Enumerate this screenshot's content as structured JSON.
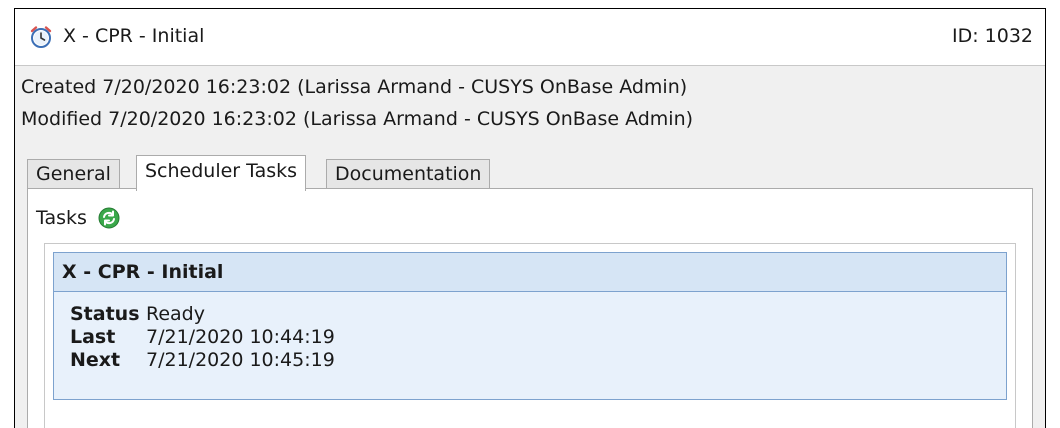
{
  "header": {
    "icon": "alarm-clock-icon",
    "title": "X - CPR - Initial",
    "id_text": "ID: 1032"
  },
  "meta": {
    "created_label": "Created",
    "created_value": "7/20/2020 16:23:02 (Larissa Armand - CUSYS OnBase Admin)",
    "modified_label": "Modified",
    "modified_value": "7/20/2020 16:23:02 (Larissa Armand - CUSYS OnBase Admin)"
  },
  "tabs": [
    {
      "label": "General",
      "active": false
    },
    {
      "label": "Scheduler Tasks",
      "active": true
    },
    {
      "label": "Documentation",
      "active": false
    }
  ],
  "tasks": {
    "label": "Tasks",
    "refresh_icon": "refresh-icon",
    "items": [
      {
        "name": "X - CPR - Initial",
        "status_label": "Status",
        "status_value": "Ready",
        "last_label": "Last",
        "last_value": "7/21/2020 10:44:19",
        "next_label": "Next",
        "next_value": "7/21/2020 10:45:19"
      }
    ]
  },
  "colors": {
    "card_header": "#d6e5f5",
    "card_body": "#e8f1fb",
    "card_border": "#7da2ce",
    "refresh_green": "#3aa84a"
  }
}
